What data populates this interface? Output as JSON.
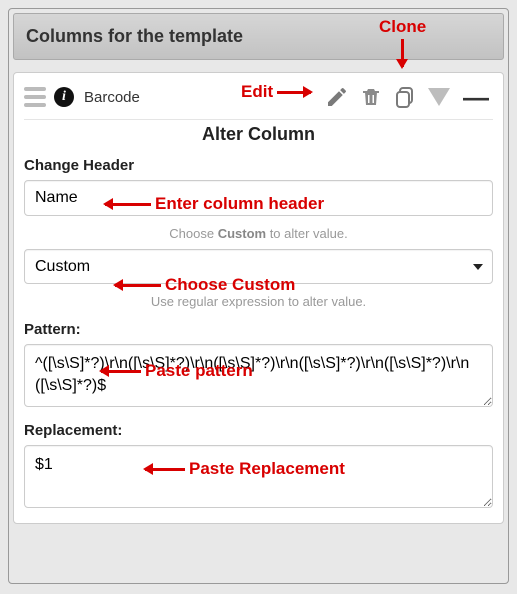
{
  "header": {
    "title": "Columns for the template"
  },
  "column": {
    "name": "Barcode"
  },
  "section": {
    "title": "Alter Column",
    "change_header_label": "Change Header",
    "change_header_value": "Name",
    "hint1_prefix": "Choose ",
    "hint1_bold": "Custom",
    "hint1_suffix": " to alter value.",
    "mode_value": "Custom",
    "hint2": "Use regular expression to alter value.",
    "pattern_label": "Pattern:",
    "pattern_value": "^([\\s\\S]*?)\\r\\n([\\s\\S]*?)\\r\\n([\\s\\S]*?)\\r\\n([\\s\\S]*?)\\r\\n([\\s\\S]*?)\\r\\n ([\\s\\S]*?)$",
    "replacement_label": "Replacement:",
    "replacement_value": "$1"
  },
  "annotations": {
    "clone": "Clone",
    "edit": "Edit",
    "enter_header": "Enter column header",
    "choose_custom": "Choose Custom",
    "paste_pattern": "Paste pattern",
    "paste_replacement": "Paste Replacement"
  }
}
